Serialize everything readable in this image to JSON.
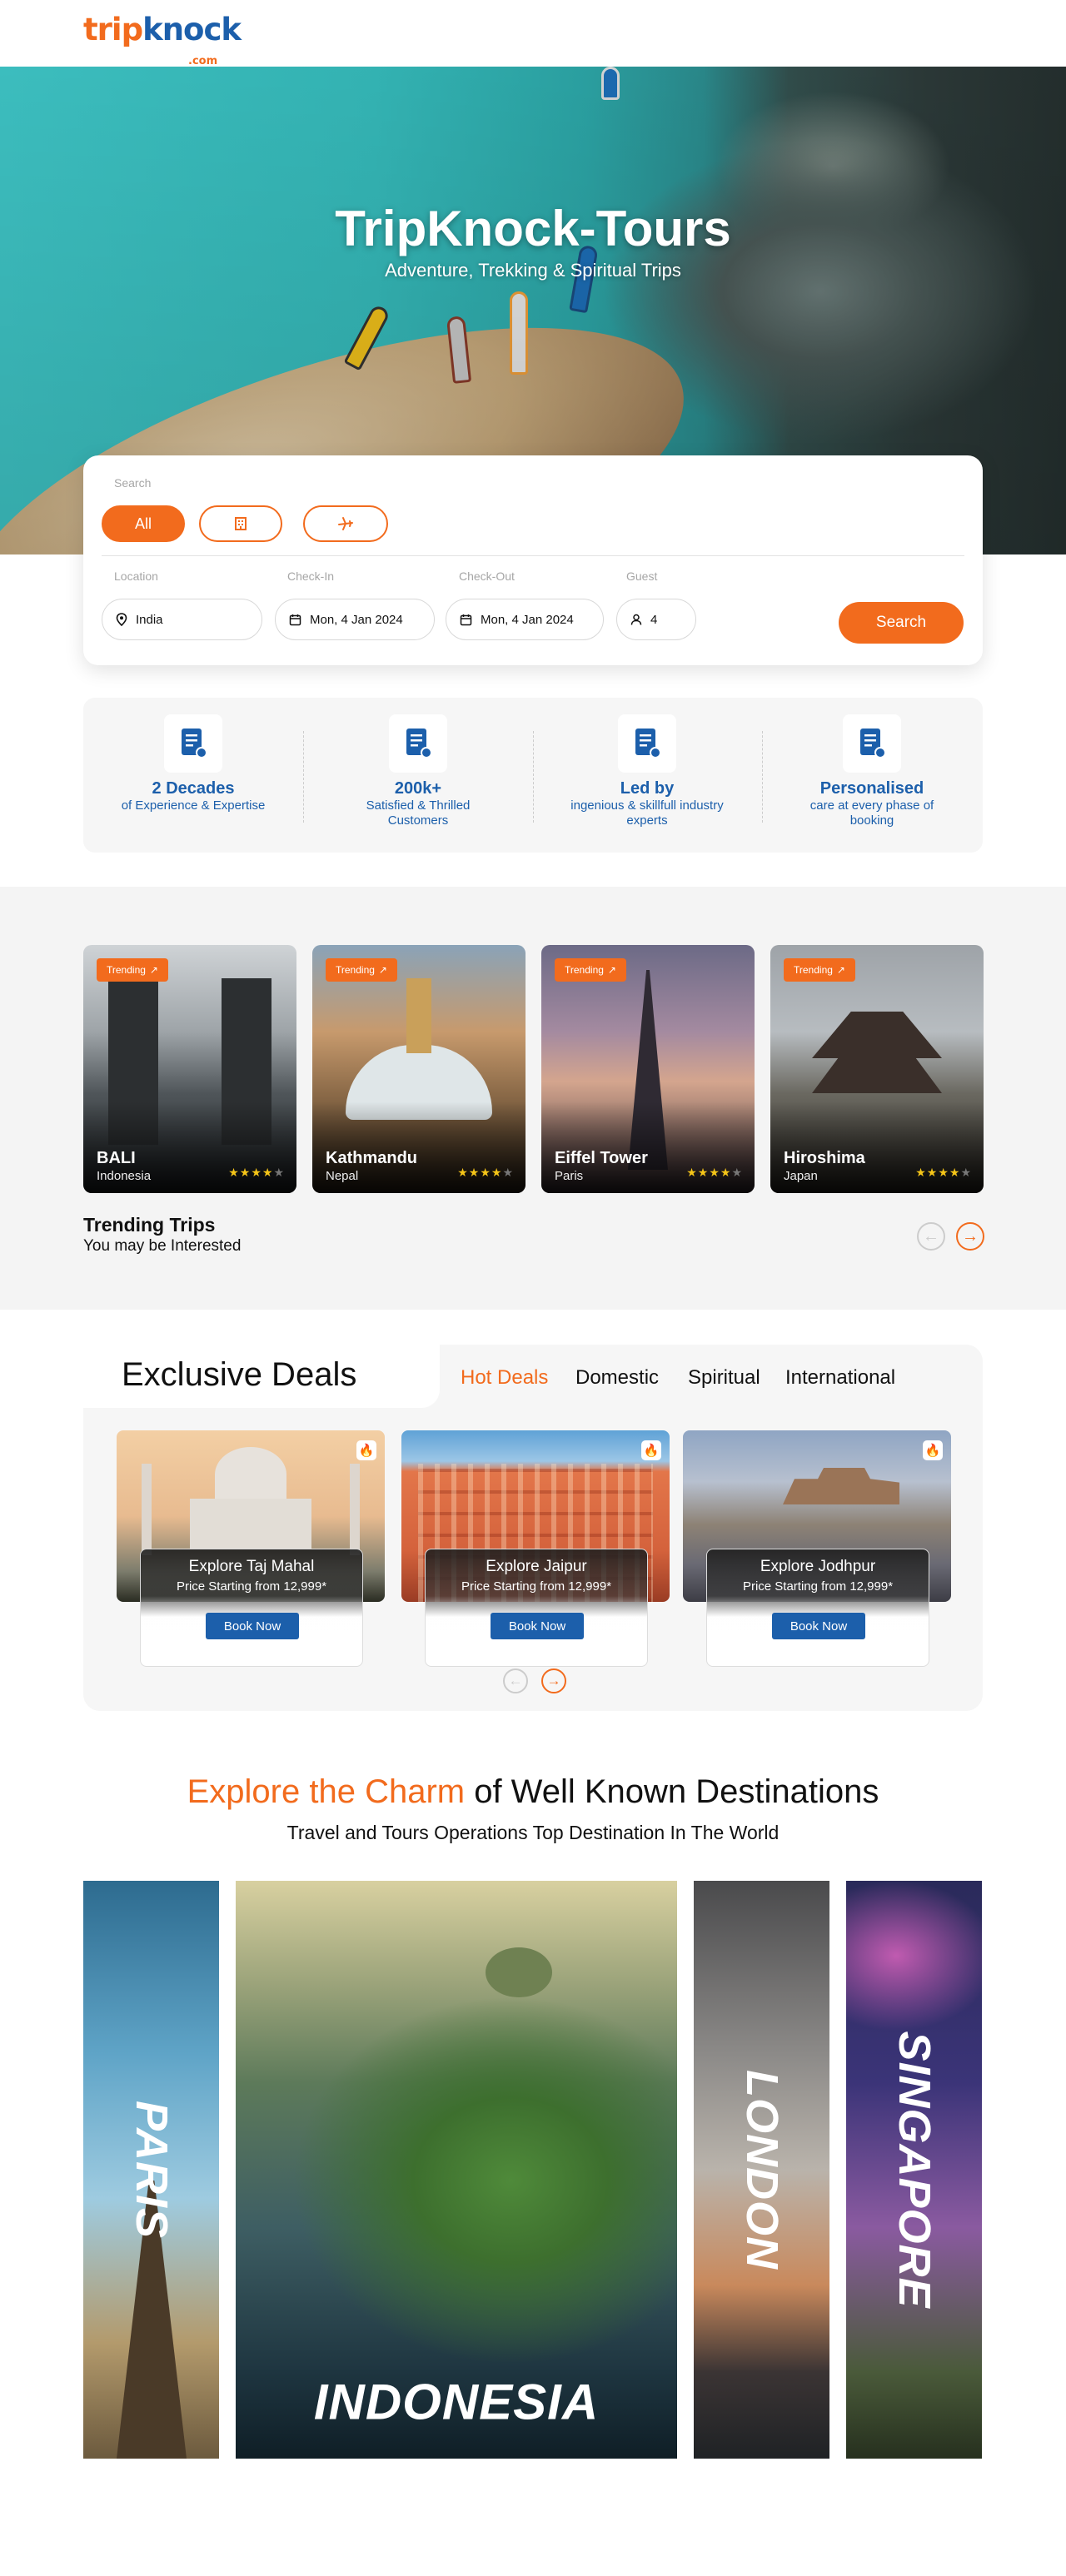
{
  "brand": {
    "name_part1": "trip",
    "name_part2": "knock",
    "domain_suffix": ".com",
    "orange": "#f26b1d",
    "blue": "#1c5fab"
  },
  "hero": {
    "title": "TripKnock-Tours",
    "subtitle": "Adventure, Trekking & Spiritual Trips"
  },
  "search": {
    "label": "Search",
    "tabs": [
      {
        "label": "All",
        "icon": ""
      },
      {
        "label": "",
        "icon": "hotel-icon"
      },
      {
        "label": "",
        "icon": "plane-icon"
      }
    ],
    "fields": {
      "location": {
        "label": "Location",
        "value": "India"
      },
      "checkin": {
        "label": "Check-In",
        "value": "Mon, 4 Jan 2024"
      },
      "checkout": {
        "label": "Check-Out",
        "value": "Mon, 4 Jan 2024"
      },
      "guest": {
        "label": "Guest",
        "value": "4"
      }
    },
    "button": "Search"
  },
  "features": [
    {
      "title": "2 Decades",
      "desc": "of Experience & Expertise"
    },
    {
      "title": "200k+",
      "desc": "Satisfied & Thrilled Customers"
    },
    {
      "title": "Led by",
      "desc": "ingenious & skillfull industry experts"
    },
    {
      "title": "Personalised",
      "desc": "care at every phase of booking"
    }
  ],
  "trending": {
    "badge": "Trending",
    "heading": "Trending Trips",
    "subheading": "You may be Interested",
    "cards": [
      {
        "name": "BALI",
        "location": "Indonesia",
        "rating": 4
      },
      {
        "name": "Kathmandu",
        "location": "Nepal",
        "rating": 4
      },
      {
        "name": "Eiffel Tower",
        "location": "Paris",
        "rating": 4
      },
      {
        "name": "Hiroshima",
        "location": "Japan",
        "rating": 4
      }
    ]
  },
  "deals": {
    "title": "Exclusive Deals",
    "tabs": [
      "Hot Deals",
      "Domestic",
      "Spiritual",
      "International"
    ],
    "active_tab": 0,
    "book_label": "Book Now",
    "cards": [
      {
        "title": "Explore Taj Mahal",
        "price": "Price Starting from 12,999*"
      },
      {
        "title": "Explore Jaipur",
        "price": "Price Starting from 12,999*"
      },
      {
        "title": "Explore Jodhpur",
        "price": "Price Starting from 12,999*"
      }
    ]
  },
  "explore": {
    "title_highlight": "Explore the Charm",
    "title_rest": " of Well Known Destinations",
    "subtitle": "Travel and Tours Operations Top Destination In The World",
    "destinations": [
      "PARIS",
      "INDONESIA",
      "LONDON",
      "SINGAPORE"
    ]
  }
}
